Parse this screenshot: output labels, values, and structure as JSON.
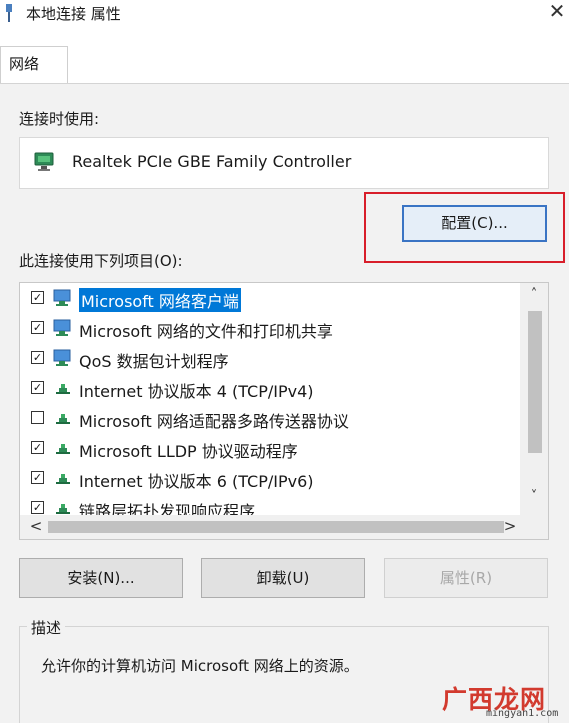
{
  "window": {
    "title": "本地连接 属性",
    "close_glyph": "✕"
  },
  "tabs": [
    {
      "label": "网络",
      "active": true
    }
  ],
  "connect_using": {
    "label": "连接时使用:",
    "adapter": "Realtek PCIe GBE Family Controller"
  },
  "configure_button": {
    "label": "配置(C)...",
    "highlight_color": "#d81e2a"
  },
  "items_label": "此连接使用下列项目(O):",
  "items": [
    {
      "label": "Microsoft 网络客户端",
      "checked": true,
      "icon": "network-client-icon",
      "selected": true
    },
    {
      "label": "Microsoft 网络的文件和打印机共享",
      "checked": true,
      "icon": "network-client-icon",
      "selected": false
    },
    {
      "label": "QoS 数据包计划程序",
      "checked": true,
      "icon": "network-client-icon",
      "selected": false
    },
    {
      "label": "Internet 协议版本 4 (TCP/IPv4)",
      "checked": true,
      "icon": "protocol-icon",
      "selected": false
    },
    {
      "label": "Microsoft 网络适配器多路传送器协议",
      "checked": false,
      "icon": "protocol-icon",
      "selected": false
    },
    {
      "label": "Microsoft LLDP 协议驱动程序",
      "checked": true,
      "icon": "protocol-icon",
      "selected": false
    },
    {
      "label": "Internet 协议版本 6 (TCP/IPv6)",
      "checked": true,
      "icon": "protocol-icon",
      "selected": false
    },
    {
      "label": "链路层拓扑发现响应程序",
      "checked": true,
      "icon": "protocol-icon",
      "selected": false
    }
  ],
  "scroll": {
    "up": "˄",
    "down": "˅",
    "left": "<",
    "right": ">"
  },
  "buttons": {
    "install": "安装(N)...",
    "uninstall": "卸载(U)",
    "properties": "属性(R)"
  },
  "description": {
    "legend": "描述",
    "text": "允许你的计算机访问 Microsoft 网络上的资源。"
  },
  "watermark": {
    "main": "广西龙网",
    "sub": "mingyan1.com"
  },
  "colors": {
    "selection": "#0078d7",
    "highlight": "#d81e2a",
    "accent_border": "#3a74c4"
  }
}
